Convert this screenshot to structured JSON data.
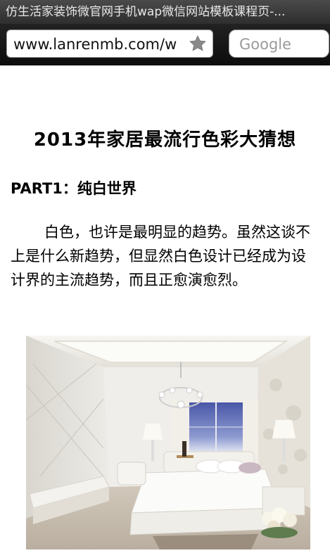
{
  "browser": {
    "tab_title": "仿生活家装饰微官网手机wap微信网站模板课程页-...",
    "url": "www.lanrenmb.com/w",
    "search_placeholder": "Google",
    "bookmark_icon": "star-icon"
  },
  "article": {
    "title": "2013年家居最流行色彩大猜想",
    "section_heading": "PART1：纯白世界",
    "paragraph": "白色，也许是最明显的趋势。虽然这谈不上是什么新趋势，但显然白色设计已经成为设计界的主流趋势，而且正愈演愈烈。"
  }
}
